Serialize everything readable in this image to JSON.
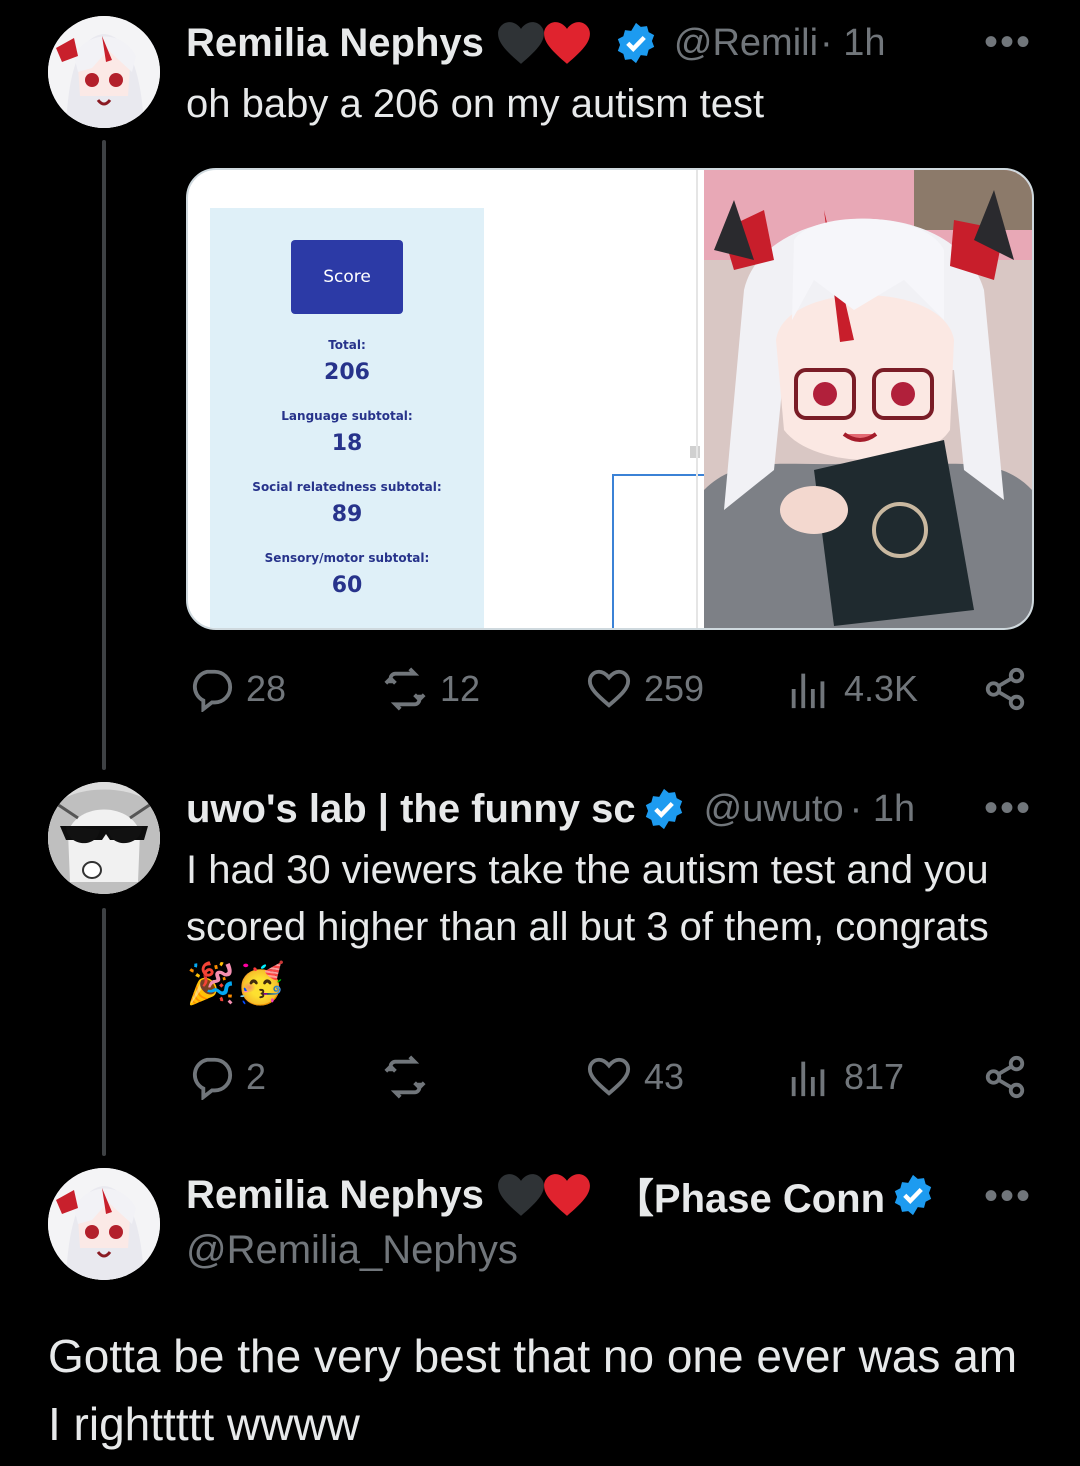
{
  "tweets": [
    {
      "display_name": "Remilia Nephys",
      "handle": "@Remili",
      "time": "· 1h",
      "text": "oh baby a 206 on my autism test",
      "stats": {
        "replies": "28",
        "retweets": "12",
        "likes": "259",
        "views": "4.3K"
      }
    },
    {
      "display_name": "uwo's lab | the funny sc",
      "handle": "@uwuto",
      "time": "· 1h",
      "text": "I had 30 viewers take the autism test and you scored higher than all but 3 of them, congrats 🎉🥳",
      "stats": {
        "replies": "2",
        "retweets": "",
        "likes": "43",
        "views": "817"
      }
    }
  ],
  "main_post": {
    "display_name": "Remilia Nephys",
    "affiliation": "【Phase Conn",
    "handle": "@Remilia_Nephys",
    "text": "Gotta be the very best that no one ever was am I righttttt wwww"
  },
  "score_card": {
    "button": "Score",
    "total_label": "Total:",
    "total": "206",
    "language_label": "Language subtotal:",
    "language": "18",
    "social_label": "Social relatedness subtotal:",
    "social": "89",
    "sensory_label": "Sensory/motor subtotal:",
    "sensory": "60"
  },
  "more_glyph": "•••",
  "colors": {
    "background": "#000000",
    "text": "#e7e9ea",
    "muted": "#71767b",
    "verified": "#1d9bf0",
    "heart_red": "#e0232e",
    "heart_black": "#2f3336"
  }
}
